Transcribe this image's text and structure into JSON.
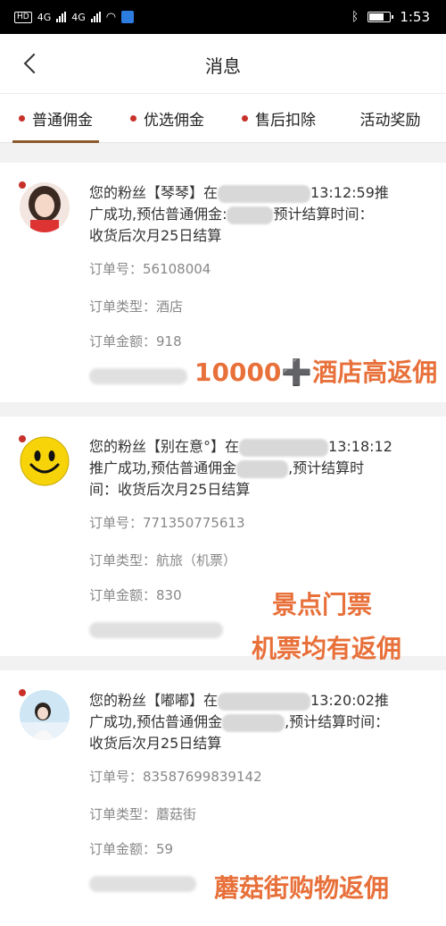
{
  "status_bar": {
    "left_labels": [
      "HD",
      "4G",
      "4G"
    ],
    "time": "1:53"
  },
  "header": {
    "title": "消息"
  },
  "tabs": [
    {
      "label": "普通佣金",
      "dot": true,
      "active": true
    },
    {
      "label": "优选佣金",
      "dot": true,
      "active": false
    },
    {
      "label": "售后扣除",
      "dot": true,
      "active": false
    },
    {
      "label": "活动奖励",
      "dot": false,
      "active": false
    }
  ],
  "messages": [
    {
      "msg_prefix": "您的粉丝【琴琴】在",
      "msg_time": "13:12:59推",
      "msg_line2": "广成功,预估普通佣金:",
      "msg_line2b": "预计结算时间：",
      "msg_line3": "收货后次月25日结算",
      "order_no": "订单号：56108004",
      "order_type": "订单类型：酒店",
      "order_amount": "订单金额：918",
      "promo": "10000➕酒店高返佣"
    },
    {
      "msg_prefix": "您的粉丝【别在意°】在",
      "msg_time": "13:18:12",
      "msg_line2": "推广成功,预估普通佣金",
      "msg_line2b": ",预计结算时",
      "msg_line3": "间：收货后次月25日结算",
      "order_no": "订单号：771350775613",
      "order_type": "订单类型：航旅（机票）",
      "order_amount": "订单金额：830",
      "promo_line1": "景点门票",
      "promo_line2": "机票均有返佣"
    },
    {
      "msg_prefix": "您的粉丝【嘟嘟】在",
      "msg_time": "13:20:02推",
      "msg_line2": "广成功,预估普通佣金",
      "msg_line2b": ",预计结算时间：",
      "msg_line3": "收货后次月25日结算",
      "order_no": "订单号：83587699839142",
      "order_type": "订单类型：蘑菇街",
      "order_amount": "订单金额：59",
      "promo": "蘑菇街购物返佣"
    }
  ]
}
